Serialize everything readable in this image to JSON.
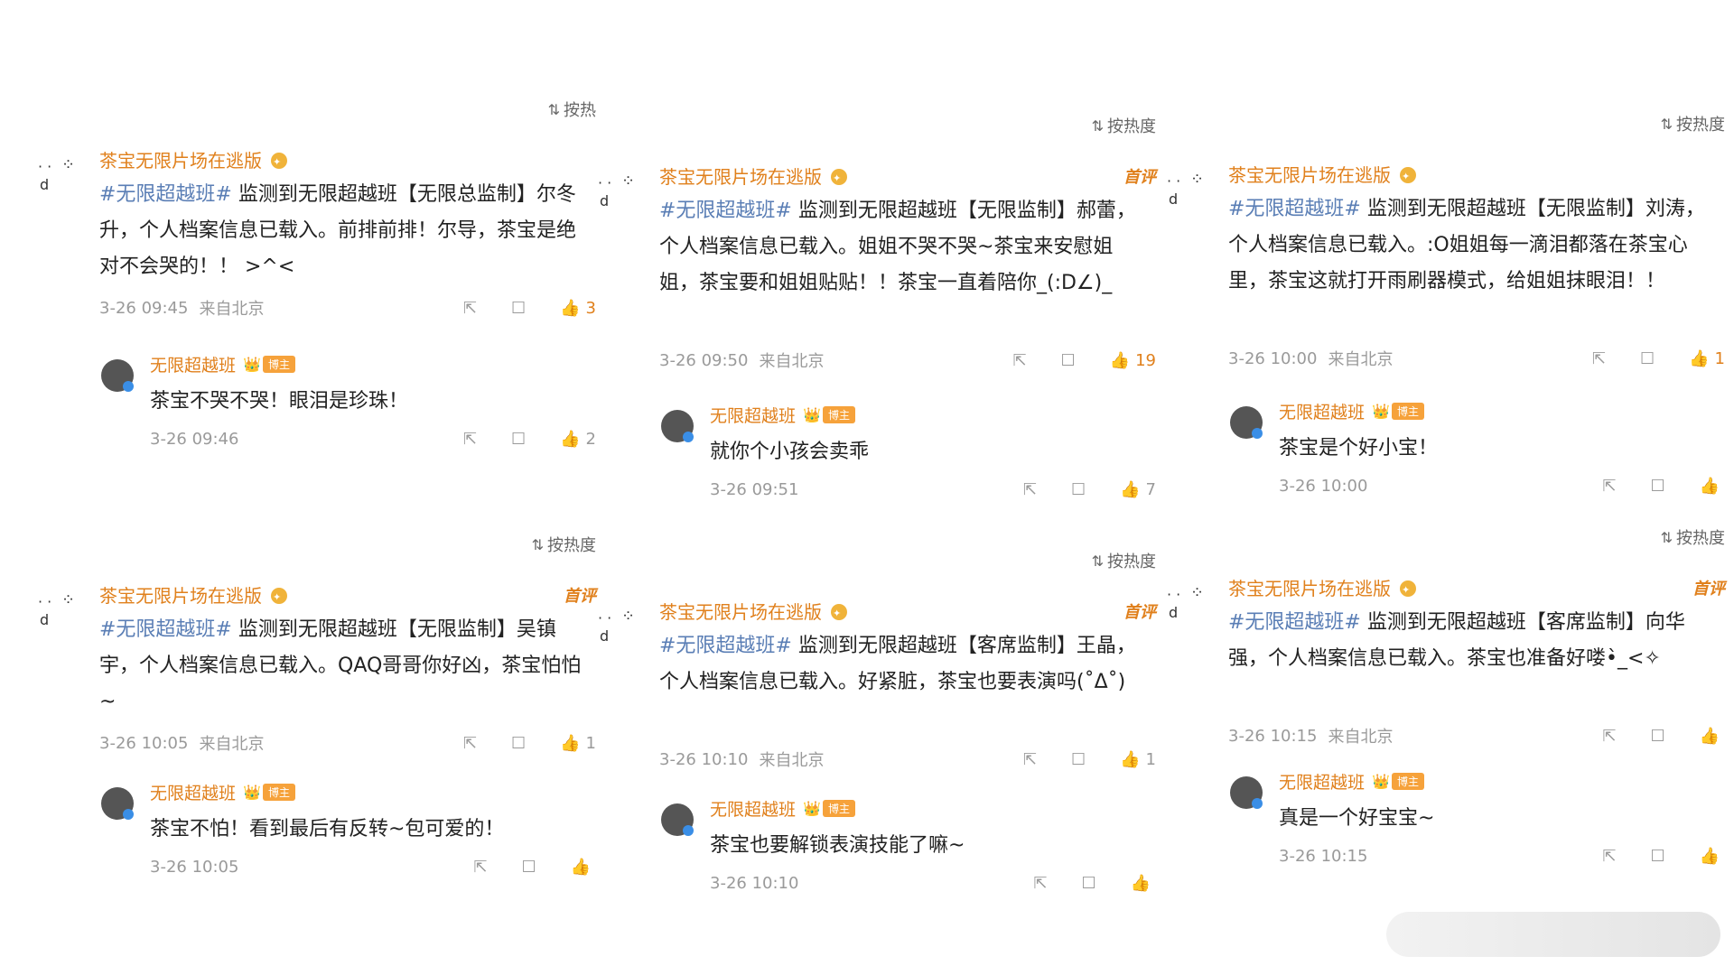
{
  "sort_label": "按热度",
  "panels": [
    {
      "sort_label": "按热",
      "nickname": "茶宝无限片场在逃版",
      "is_first": false,
      "topic": "#无限超越班#",
      "text": " 监测到无限超越班【无限总监制】尔冬升，个人档案信息已载入。前排前排！尔导，茶宝是绝对不会哭的！！ >^<",
      "time": "3-26 09:45",
      "location": "来自北京",
      "likes": "3",
      "liked": true,
      "reply": {
        "nickname": "无限超越班",
        "badge": "博主",
        "text": "茶宝不哭不哭！眼泪是珍珠！",
        "time": "3-26 09:46",
        "likes": "2"
      }
    },
    {
      "sort_label": "按热度",
      "nickname": "茶宝无限片场在逃版",
      "is_first": true,
      "first_label": "首评",
      "topic": "#无限超越班#",
      "text": " 监测到无限超越班【无限监制】郝蕾，个人档案信息已载入。姐姐不哭不哭~茶宝来安慰姐姐，茶宝要和姐姐贴贴！！茶宝一直着陪你_(:D∠)_",
      "time": "3-26 09:50",
      "location": "来自北京",
      "likes": "19",
      "liked": true,
      "reply": {
        "nickname": "无限超越班",
        "badge": "博主",
        "text": "就你个小孩会卖乖",
        "time": "3-26 09:51",
        "likes": "7"
      }
    },
    {
      "sort_label": "按热度",
      "nickname": "茶宝无限片场在逃版",
      "is_first": false,
      "topic": "#无限超越班#",
      "text": " 监测到无限超越班【无限监制】刘涛，个人档案信息已载入。:O姐姐每一滴泪都落在茶宝心里，茶宝这就打开雨刷器模式，给姐姐抹眼泪！！",
      "time": "3-26 10:00",
      "location": "来自北京",
      "likes": "1",
      "liked": true,
      "reply": {
        "nickname": "无限超越班",
        "badge": "博主",
        "text": "茶宝是个好小宝！",
        "time": "3-26 10:00",
        "likes": ""
      }
    },
    {
      "sort_label": "按热度",
      "nickname": "茶宝无限片场在逃版",
      "is_first": true,
      "first_label": "首评",
      "topic": "#无限超越班#",
      "text": " 监测到无限超越班【无限监制】吴镇宇，个人档案信息已载入。QAQ哥哥你好凶，茶宝怕怕~",
      "time": "3-26 10:05",
      "location": "来自北京",
      "likes": "1",
      "liked": false,
      "reply": {
        "nickname": "无限超越班",
        "badge": "博主",
        "text": "茶宝不怕！看到最后有反转~包可爱的！",
        "time": "3-26 10:05",
        "likes": ""
      }
    },
    {
      "sort_label": "按热度",
      "nickname": "茶宝无限片场在逃版",
      "is_first": true,
      "first_label": "首评",
      "topic": "#无限超越班#",
      "text": " 监测到无限超越班【客席监制】王晶，个人档案信息已载入。好紧脏，茶宝也要表演吗(˚Δ˚)",
      "time": "3-26 10:10",
      "location": "来自北京",
      "likes": "1",
      "liked": false,
      "reply": {
        "nickname": "无限超越班",
        "badge": "博主",
        "text": "茶宝也要解锁表演技能了嘛~",
        "time": "3-26 10:10",
        "likes": ""
      }
    },
    {
      "sort_label": "按热度",
      "nickname": "茶宝无限片场在逃版",
      "is_first": true,
      "first_label": "首评",
      "topic": "#无限超越班#",
      "text": " 监测到无限超越班【客席监制】向华强，个人档案信息已载入。茶宝也准备好喽•̀_<✧",
      "time": "3-26 10:15",
      "location": "来自北京",
      "likes": "",
      "liked": false,
      "reply": {
        "nickname": "无限超越班",
        "badge": "博主",
        "text": "真是一个好宝宝~",
        "time": "3-26 10:15",
        "likes": ""
      }
    }
  ]
}
